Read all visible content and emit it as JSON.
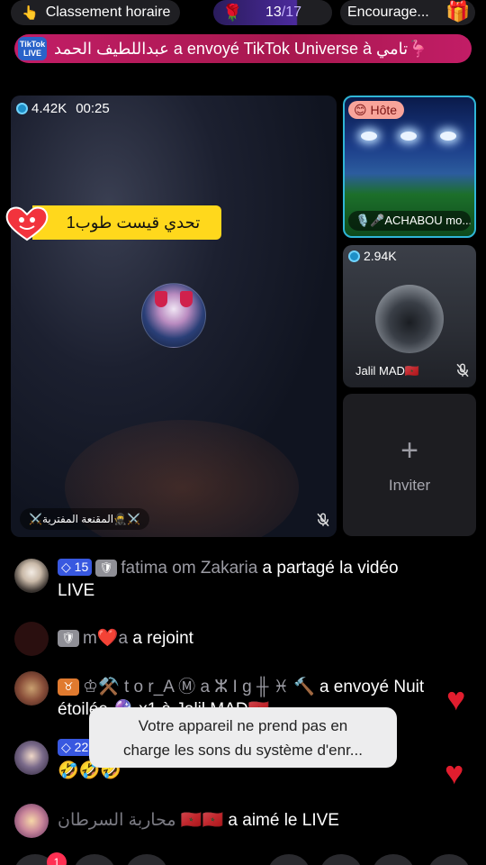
{
  "topbar": {
    "hourly_rank": "Classement horaire",
    "gift_count": "13",
    "gift_total": "/17",
    "encourage": "Encourage..."
  },
  "banner": {
    "logo_line1": "TikTok",
    "logo_line2": "LIVE",
    "text": "عبداللطيف الحمد a envoyé TikTok Universe à تامي🦩"
  },
  "main": {
    "viewers": "4.42K",
    "duration": "00:25",
    "challenge": "تحدي قيست طوب1",
    "name": "⚔️المقنعة المفترية🥷⚔️"
  },
  "host": {
    "badge": "Hôte",
    "name": "🎙️🎤ACHABOU mo..."
  },
  "guest": {
    "viewers": "2.94K",
    "name": "Jalil MAD🇲🇦"
  },
  "invite": {
    "label": "Inviter"
  },
  "chat": [
    {
      "level": "15",
      "user": "fatima om Zakaria",
      "text": " a partagé la vidéo LIVE"
    },
    {
      "user": "m❤️a",
      "text": " a rejoint"
    },
    {
      "user": "♔⚒️ t o r_A Ⓜ a ⵣ I g ╫ ♓ 🔨",
      "text": " a envoyé Nuit étoilée 🔮 x1 à Jalil MAD🇲🇦"
    },
    {
      "level": "22",
      "user": "",
      "text": "🤣🤣🤣"
    },
    {
      "user": "محاربة السرطان 🇲🇦🇲🇦",
      "text": " a aimé le LIVE"
    }
  ],
  "toast": {
    "line1": "Votre appareil ne prend pas en",
    "line2": "charge les sons du système d'enr..."
  },
  "notification_count": "1",
  "colors": {
    "banner": "#c21d66",
    "challenge": "#ffd81c",
    "host_border": "#2fb5d6",
    "level_badge": "#3858e0",
    "heart": "#e11d2e"
  }
}
